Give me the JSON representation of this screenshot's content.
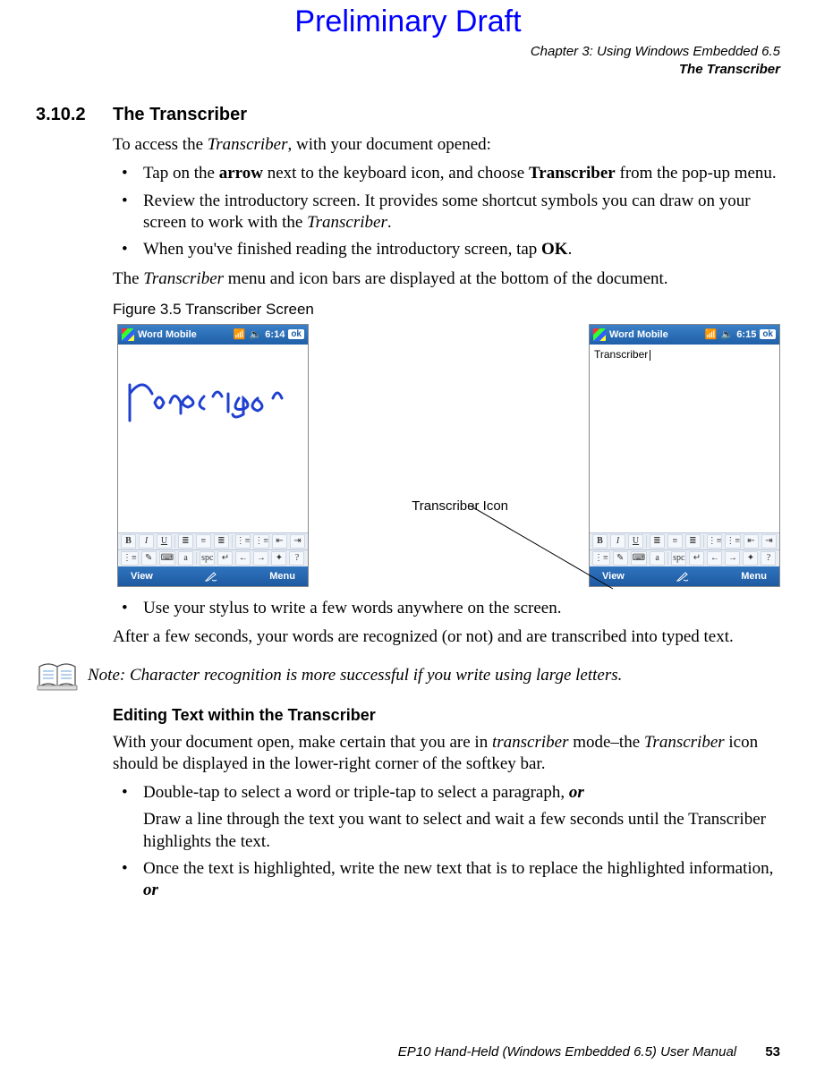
{
  "draft_header": "Preliminary Draft",
  "chapter_header": {
    "line1": "Chapter 3: Using Windows Embedded 6.5",
    "line2": "The Transcriber"
  },
  "section": {
    "number": "3.10.2",
    "title": "The Transcriber"
  },
  "intro_line_parts": {
    "p1": "To access the ",
    "p2": "Transcriber",
    "p3": ", with your document opened:"
  },
  "bullets1": {
    "b1": {
      "p1": "Tap on the ",
      "p2": "arrow",
      "p3": " next to the keyboard icon, and choose ",
      "p4": "Transcriber",
      "p5": " from the pop-up menu."
    },
    "b2": {
      "p1": "Review the introductory screen. It provides some shortcut symbols you can draw on your screen to work with the ",
      "p2": "Transcriber",
      "p3": "."
    },
    "b3": {
      "p1": "When you've finished reading the introductory screen, tap ",
      "p2": "OK",
      "p3": "."
    }
  },
  "after_bullets1": {
    "p1": "The ",
    "p2": "Transcriber",
    "p3": " menu and icon bars are displayed at the bottom of the document."
  },
  "figure_caption": "Figure 3.5  Transcriber Screen",
  "figure_annotation": "Transcriber Icon",
  "shot": {
    "title": "Word Mobile",
    "time1": "6:14",
    "time2": "6:15",
    "ok": "ok",
    "typed": "Transcriber",
    "view": "View",
    "menu": "Menu",
    "B": "B",
    "I": "I",
    "U": "U",
    "a": "a",
    "spc": "spc",
    "left": "←",
    "right": "→",
    "enter": "↵",
    "help": "?"
  },
  "bullets2": {
    "b1": "Use your stylus to write a few words anywhere on the screen."
  },
  "after_bullets2": "After a few seconds, your words are recognized (or not) and are transcribed into typed text.",
  "note_text": "Note: Character recognition is more successful if you write using large letters.",
  "subhead": "Editing Text within the Transcriber",
  "edit_para": {
    "p1": "With your document open, make certain that you are in ",
    "p2": "transcriber",
    "p3": " mode–the ",
    "p4": "Transcriber",
    "p5": " icon should be displayed in the lower-right corner of the softkey bar."
  },
  "bullets3": {
    "b1": {
      "p1": "Double-tap to select a word or triple-tap to select a paragraph, ",
      "p2": "or"
    },
    "b1sub": "Draw a line through the text you want to select and wait a few seconds until the Transcriber highlights the text.",
    "b2": {
      "p1": "Once the text is highlighted, write the new text that is to replace the highlighted information, ",
      "p2": "or"
    }
  },
  "footer": {
    "title": "EP10 Hand-Held (Windows Embedded 6.5) User Manual",
    "page": "53"
  }
}
